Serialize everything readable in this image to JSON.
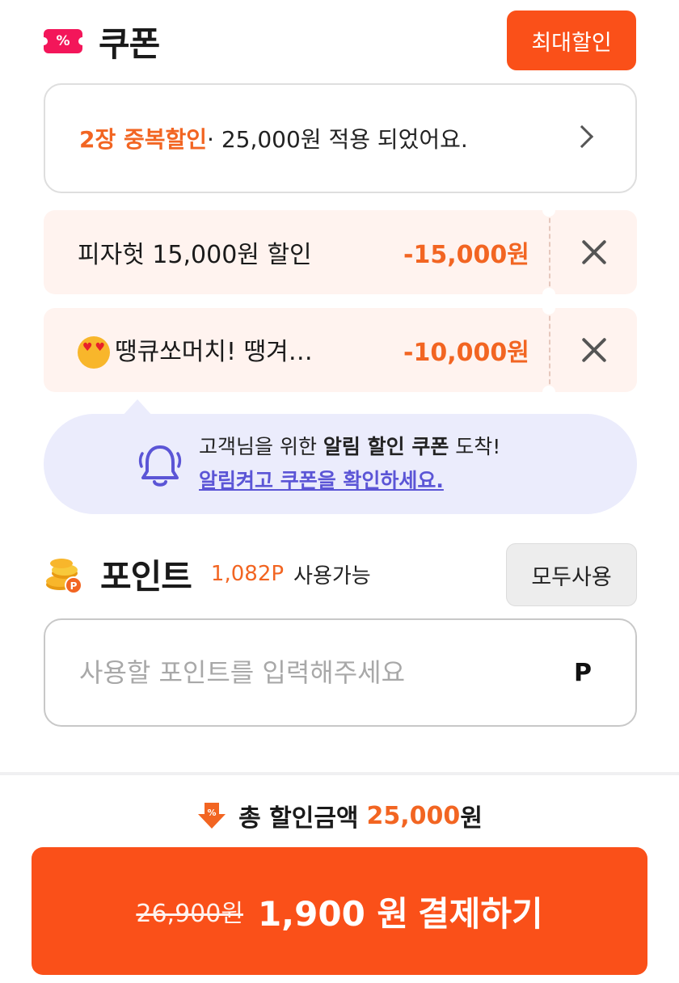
{
  "coupon": {
    "title": "쿠폰",
    "icon_text": "%",
    "max_discount_label": "최대할인",
    "applied": {
      "highlight": "2장 중복할인",
      "rest": "· 25,000원 적용 되었어요."
    },
    "items": [
      {
        "name": "피자헛 15,000원 할인",
        "amount": "-15,000원"
      },
      {
        "name": "땡큐쏘머치! 땡겨…",
        "amount": "-10,000원"
      }
    ]
  },
  "notice": {
    "line1_prefix": "고객님을 위한 ",
    "line1_bold": "알림 할인 쿠폰",
    "line1_suffix": " 도착!",
    "link": "알림켜고 쿠폰을 확인하세요."
  },
  "point": {
    "title": "포인트",
    "available": "1,082P",
    "available_label": "사용가능",
    "use_all_label": "모두사용",
    "input_placeholder": "사용할 포인트를 입력해주세요",
    "unit": "P"
  },
  "summary": {
    "total_label": "총 할인금액",
    "total_amount": "25,000",
    "total_unit": "원"
  },
  "payment": {
    "original_price": "26,900원",
    "final_price": "1,900 원",
    "label": "결제하기"
  },
  "colors": {
    "accent": "#fa5019",
    "highlight_text": "#f26522",
    "coupon_bg": "#fff3ef",
    "notice_bg": "#ebecfc",
    "link": "#5b55d6",
    "ticket_icon": "#f3165a"
  }
}
